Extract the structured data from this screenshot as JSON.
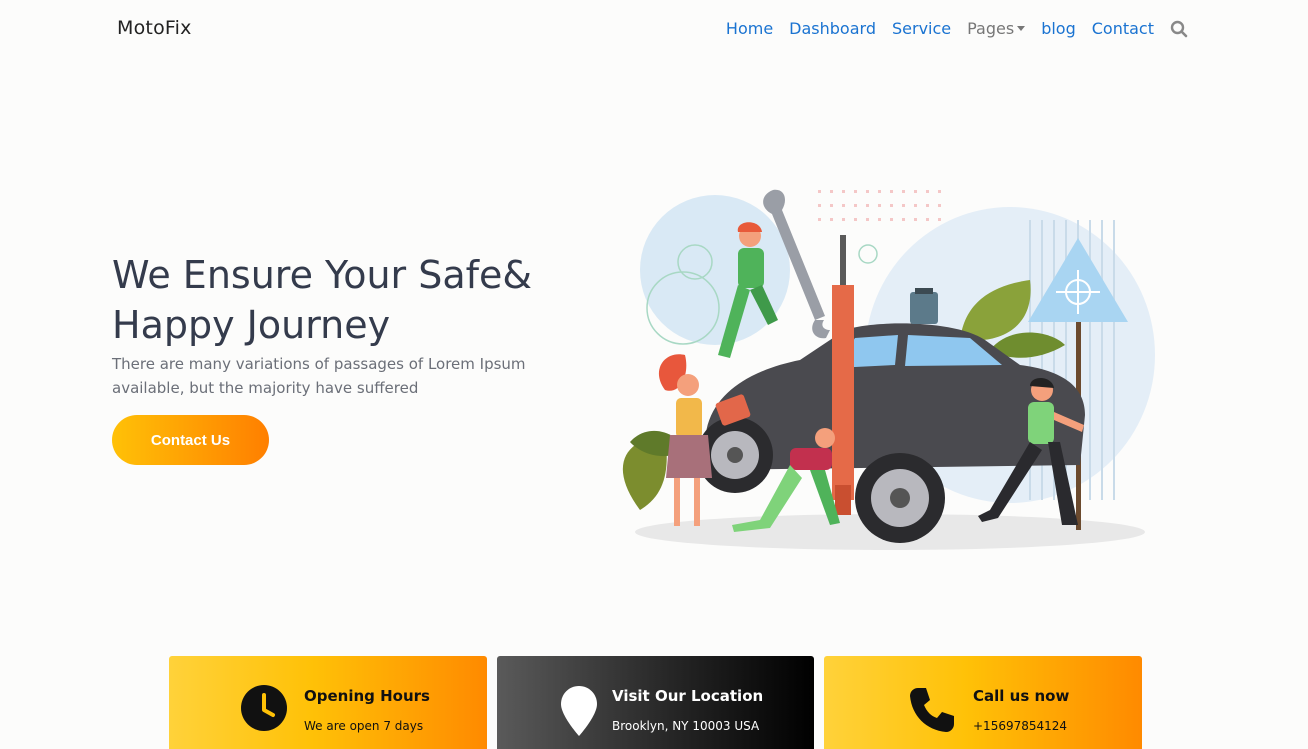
{
  "brand": "MotoFix",
  "nav": {
    "items": [
      "Home",
      "Dashboard",
      "Service",
      "Pages",
      "blog",
      "Contact"
    ],
    "search_icon": "search-icon"
  },
  "hero": {
    "title_line1": "We Ensure Your Safe&",
    "title_line2": "Happy Journey",
    "subtitle": "There are many variations of passages of Lorem Ipsum available, but the majority have suffered",
    "cta_label": "Contact Us",
    "cta_gradient": [
      "#ffc107",
      "#ff7f00"
    ]
  },
  "cards": [
    {
      "title": "Opening Hours",
      "text": "We are open 7 days",
      "icon": "clock-icon"
    },
    {
      "title": "Visit Our Location",
      "text": "Brooklyn, NY 10003 USA",
      "icon": "map-pin-icon"
    },
    {
      "title": "Call us now",
      "text": "+15697854124",
      "icon": "phone-icon"
    }
  ],
  "colors": {
    "link": "#1a73d1",
    "heading": "#343b4c",
    "accent_yellow": "#ffc107",
    "accent_orange": "#ff7f00"
  }
}
